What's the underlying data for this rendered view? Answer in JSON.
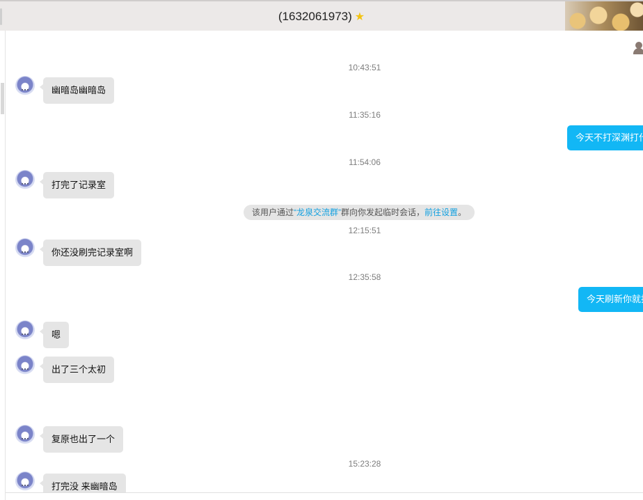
{
  "window": {
    "title": "(1632061973)",
    "star_icon": "star-icon"
  },
  "messages": [
    {
      "time": "10:43:51"
    },
    {
      "sender": "other",
      "text": "幽暗岛幽暗岛"
    },
    {
      "time": "11:35:16"
    },
    {
      "sender": "me",
      "text": "今天不打深渊打什"
    },
    {
      "time": "11:54:06"
    },
    {
      "sender": "other",
      "text": "打完了记录室"
    },
    {
      "notice": {
        "before": "该用户通过",
        "group": "“龙泉交流群”",
        "after": "群向你发起临时会话，",
        "link": "前往设置",
        "end": "。"
      }
    },
    {
      "time": "12:15:51"
    },
    {
      "sender": "other",
      "text": "你还没刷完记录室啊"
    },
    {
      "time": "12:35:58"
    },
    {
      "sender": "me",
      "text": "今天刷新你就打"
    },
    {
      "sender": "other",
      "text": "嗯"
    },
    {
      "sender": "other",
      "text": "出了三个太初"
    },
    {
      "sender": "other",
      "text": "复原也出了一个"
    },
    {
      "time": "15:23:28"
    },
    {
      "sender": "other",
      "text": "打完没 来幽暗岛"
    }
  ],
  "colors": {
    "my_bubble": "#12b7f5",
    "other_bubble": "#e5e5e5",
    "link": "#12a0e0",
    "star": "#f3c311"
  },
  "icons": [
    "contact-icon",
    "avatar"
  ]
}
